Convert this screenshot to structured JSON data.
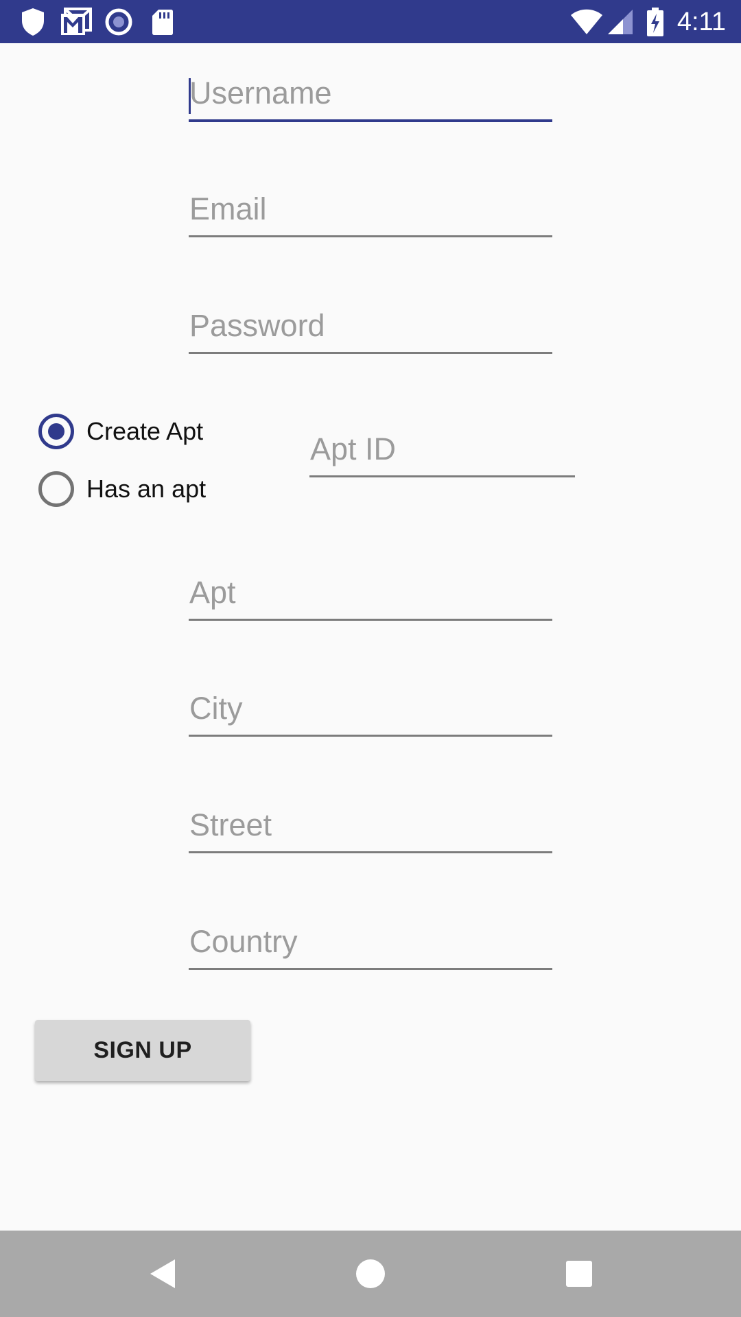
{
  "status_bar": {
    "time": "4:11",
    "left_icons": [
      "shield-icon",
      "gmail-icon",
      "record-icon",
      "sd-card-icon"
    ],
    "right_icons": [
      "wifi-icon",
      "cell-signal-icon",
      "battery-charging-icon"
    ],
    "background_color": "#303a8c"
  },
  "form": {
    "username": {
      "placeholder": "Username",
      "value": ""
    },
    "email": {
      "placeholder": "Email",
      "value": ""
    },
    "password": {
      "placeholder": "Password",
      "value": ""
    },
    "apt_id": {
      "placeholder": "Apt ID",
      "value": ""
    },
    "apt": {
      "placeholder": "Apt",
      "value": ""
    },
    "city": {
      "placeholder": "City",
      "value": ""
    },
    "street": {
      "placeholder": "Street",
      "value": ""
    },
    "country": {
      "placeholder": "Country",
      "value": ""
    }
  },
  "apt_choice": {
    "options": [
      {
        "label": "Create Apt",
        "selected": true
      },
      {
        "label": "Has an apt",
        "selected": false
      }
    ]
  },
  "signup_button": {
    "label": "SIGN UP"
  },
  "nav_bar": {
    "buttons": [
      "back-icon",
      "home-icon",
      "recents-icon"
    ]
  },
  "colors": {
    "accent": "#303a8c",
    "background": "#fafafa",
    "underline": "#7c7c7c",
    "hint": "#9b9b9b",
    "button": "#d7d7d7",
    "nav_bar": "#a9a9a9"
  }
}
